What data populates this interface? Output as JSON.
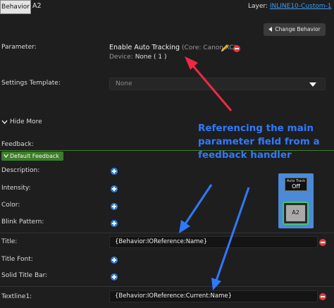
{
  "topbar": {
    "behavior_tab": "Behavior",
    "key_tab": "A2",
    "layer_prefix": "Layer:",
    "layer_name": "INLINE10-Custom-1"
  },
  "change_behavior": {
    "label": "Change Behavior"
  },
  "parameter": {
    "label": "Parameter:",
    "title": "Enable Auto Tracking",
    "core": "(Core: Canon XC)",
    "device_prefix": "Device:",
    "device_value": "None ( 1 )"
  },
  "settings_template": {
    "label": "Settings Template:",
    "value": "None"
  },
  "hide_more": {
    "label": "Hide More"
  },
  "feedback": {
    "label": "Feedback:",
    "default_label": "Default Feedback",
    "rows": {
      "description": "Description:",
      "intensity": "Intensity:",
      "color": "Color:",
      "blink_pattern": "Blink Pattern:",
      "title": "Title:",
      "title_font": "Title Font:",
      "solid_title_bar": "Solid Title Bar:",
      "textline1": "Textline1:"
    },
    "title_value": "{Behavior:IOReference:Name}",
    "textline1_value": "{Behavior:IOReference:Current:Name}"
  },
  "preview": {
    "top_line1": "Auto Track",
    "top_line2": "Off",
    "button_label": "A2"
  },
  "annotation": {
    "text": "Referencing the main parameter field from a feedback handler"
  },
  "colors": {
    "accent_blue": "#2f79ff",
    "arrow_red": "#ee2a42",
    "feedback_green": "#3e7d2a",
    "link_blue": "#3d9bf2"
  },
  "icons": [
    "arrow-left-icon",
    "pencil-icon",
    "remove-icon",
    "chevron-down-icon",
    "add-icon",
    "caret-down-icon"
  ]
}
